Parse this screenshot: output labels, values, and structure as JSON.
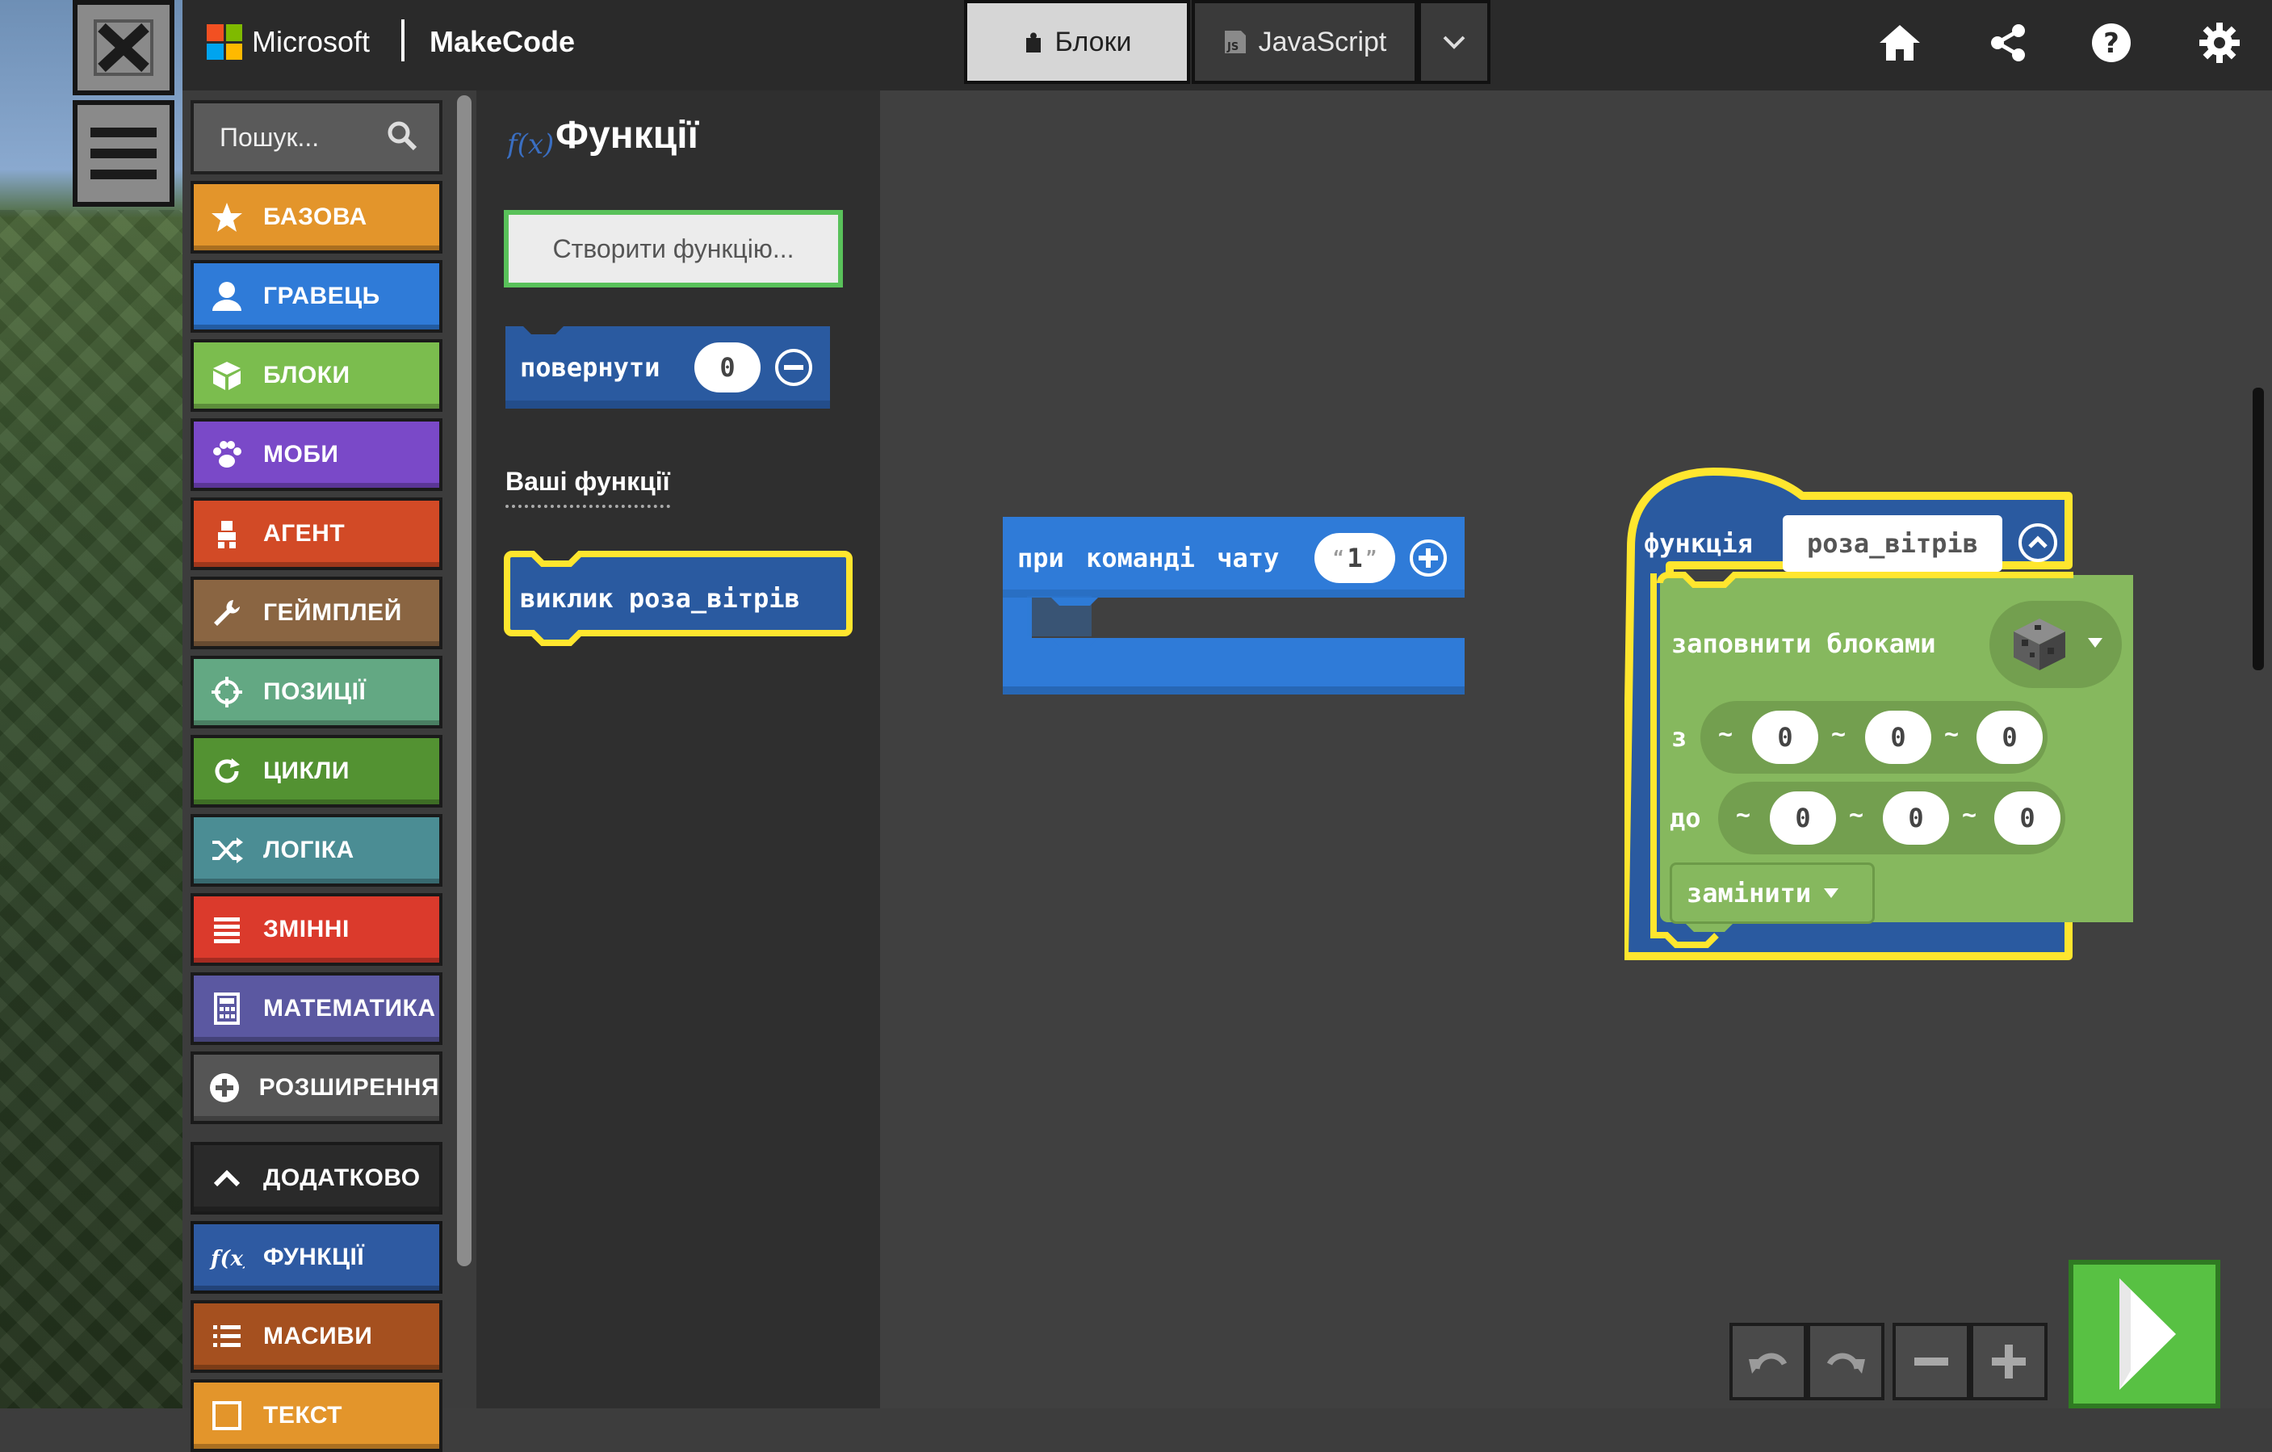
{
  "header": {
    "brand": "Microsoft",
    "product": "MakeCode",
    "tabs": [
      {
        "label": "Блоки",
        "icon": "puzzle-icon",
        "active": true
      },
      {
        "label": "JavaScript",
        "icon": "js-icon",
        "active": false
      }
    ],
    "right_icons": [
      "home-icon",
      "share-icon",
      "help-icon",
      "gear-icon"
    ]
  },
  "search": {
    "placeholder": "Пошук..."
  },
  "toolbox": {
    "categories": [
      {
        "label": "БАЗОВА",
        "color": "#e3952b",
        "icon": "star-icon"
      },
      {
        "label": "ГРАВЕЦЬ",
        "color": "#2f7bd8",
        "icon": "person-icon"
      },
      {
        "label": "БЛОКИ",
        "color": "#7bbd4e",
        "icon": "cube-icon"
      },
      {
        "label": "МОБИ",
        "color": "#7a49c8",
        "icon": "paw-icon"
      },
      {
        "label": "АГЕНТ",
        "color": "#d24a26",
        "icon": "agent-icon"
      },
      {
        "label": "ГЕЙМПЛЕЙ",
        "color": "#8a6542",
        "icon": "wrench-icon"
      },
      {
        "label": "ПОЗИЦІЇ",
        "color": "#63a883",
        "icon": "crosshair-icon"
      },
      {
        "label": "ЦИКЛИ",
        "color": "#539232",
        "icon": "loop-icon"
      },
      {
        "label": "ЛОГІКА",
        "color": "#4b8d94",
        "icon": "shuffle-icon"
      },
      {
        "label": "ЗМІННІ",
        "color": "#db3a2c",
        "icon": "list-lines-icon"
      },
      {
        "label": "МАТЕМАТИКА",
        "color": "#5b58a1",
        "icon": "calculator-icon"
      },
      {
        "label": "РОЗШИРЕННЯ",
        "color": "#555555",
        "icon": "plus-circle-icon"
      }
    ],
    "advanced": {
      "label": "ДОДАТКОВО",
      "color": "#2a2a2a",
      "icon": "chevron-up-icon"
    },
    "advanced_items": [
      {
        "label": "ФУНКЦІЇ",
        "color": "#2e5aa2",
        "icon": "fx-icon"
      },
      {
        "label": "МАСИВИ",
        "color": "#a5501f",
        "icon": "array-icon"
      },
      {
        "label": "ТЕКСТ",
        "color": "#e3952b",
        "icon": "text-icon"
      }
    ]
  },
  "flyout": {
    "title": "Функції",
    "create_button": "Створити функцію...",
    "return_block": {
      "label": "повернути",
      "value": "0"
    },
    "your_functions_label": "Ваші функції",
    "call_block": "виклик роза_вітрів"
  },
  "workspace": {
    "chat_block": {
      "label": "при команді чату",
      "value": "1"
    },
    "function_block": {
      "keyword": "функція",
      "name": "роза_вітрів",
      "fill_label": "заповнити блоками",
      "from_label": "з",
      "to_label": "до",
      "tilde": "~",
      "from": [
        "0",
        "0",
        "0"
      ],
      "to": [
        "0",
        "0",
        "0"
      ],
      "mode": "замінити"
    }
  },
  "colors": {
    "accent_green": "#58c143",
    "block_blue": "#2f7bd8",
    "block_green": "#86b85e",
    "selection_yellow": "#ffe62e"
  }
}
